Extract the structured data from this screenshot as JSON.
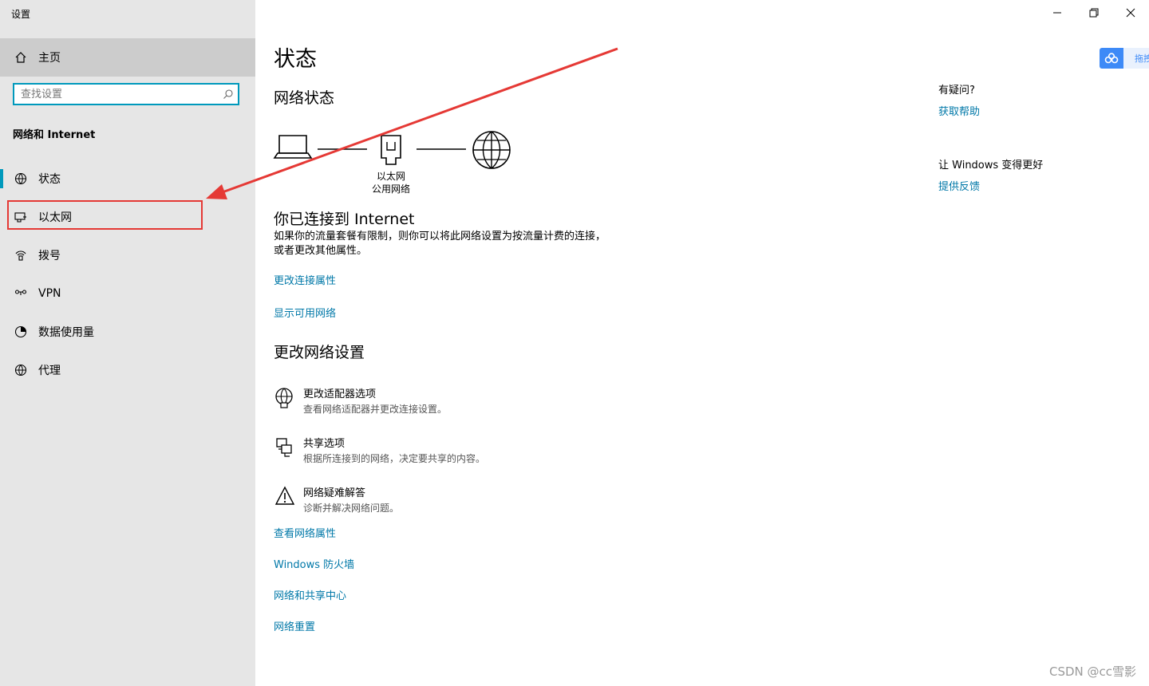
{
  "app": {
    "title": "设置"
  },
  "sidebar": {
    "home_label": "主页",
    "search_placeholder": "查找设置",
    "section_title": "网络和 Internet",
    "items": [
      {
        "label": "状态",
        "icon": "globe-status-icon",
        "active": true
      },
      {
        "label": "以太网",
        "icon": "ethernet-icon",
        "active": false
      },
      {
        "label": "拨号",
        "icon": "dialup-icon",
        "active": false
      },
      {
        "label": "VPN",
        "icon": "vpn-icon",
        "active": false
      },
      {
        "label": "数据使用量",
        "icon": "data-usage-icon",
        "active": false
      },
      {
        "label": "代理",
        "icon": "globe-icon",
        "active": false
      }
    ]
  },
  "main": {
    "title": "状态",
    "network_status_heading": "网络状态",
    "diagram": {
      "adapter_name": "以太网",
      "network_type": "公用网络"
    },
    "connected_heading": "你已连接到 Internet",
    "connected_desc": "如果你的流量套餐有限制，则你可以将此网络设置为按流量计费的连接，或者更改其他属性。",
    "links_top": [
      "更改连接属性",
      "显示可用网络"
    ],
    "change_heading": "更改网络设置",
    "options": [
      {
        "title": "更改适配器选项",
        "desc": "查看网络适配器并更改连接设置。",
        "icon": "adapter-globe-icon"
      },
      {
        "title": "共享选项",
        "desc": "根据所连接到的网络，决定要共享的内容。",
        "icon": "sharing-icon"
      },
      {
        "title": "网络疑难解答",
        "desc": "诊断并解决网络问题。",
        "icon": "warning-icon"
      }
    ],
    "links_bottom": [
      "查看网络属性",
      "Windows 防火墙",
      "网络和共享中心",
      "网络重置"
    ]
  },
  "right_panel": {
    "question": "有疑问?",
    "help_link": "获取帮助",
    "improve_heading": "让 Windows 变得更好",
    "feedback_link": "提供反馈",
    "badge_text": "拖拽"
  },
  "watermark": "CSDN @cc雪影",
  "colors": {
    "accent": "#0099bc",
    "link": "#0078a8",
    "annotation": "#e53935",
    "sidebar_bg": "#e6e6e6"
  }
}
